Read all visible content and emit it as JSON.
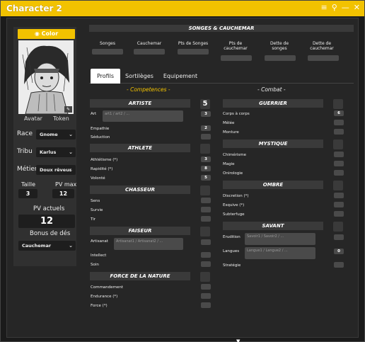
{
  "window": {
    "title": "Character 2",
    "accent": "#f2c200"
  },
  "left": {
    "color_button": "Color",
    "avatar_label": "Avatar",
    "token_label": "Token",
    "race_label": "Race",
    "race_value": "Gnome",
    "tribu_label": "Tribu",
    "tribu_value": "Karlus",
    "metier_label": "Métier",
    "metier_value": "Doux rêveur",
    "taille_label": "Taille",
    "taille_value": "3",
    "pvmax_label": "PV max",
    "pvmax_value": "12",
    "pv_actuels_label": "PV actuels",
    "pv_actuels_value": "12",
    "bonus_label": "Bonus de dés",
    "bonus_value": "Cauchemar"
  },
  "songes": {
    "title": "SONGES & CAUCHEMAR",
    "labels": [
      "Songes",
      "Cauchemar",
      "Pts de Songes",
      "Pts de cauchemar",
      "Dette de songes",
      "Dette de cauchemar"
    ]
  },
  "tabs": [
    "Profils",
    "Sortilèges",
    "Equipement"
  ],
  "competences_title": "- Competences -",
  "combat_title": "- Combat -",
  "left_cats": {
    "artiste": {
      "name": "ARTISTE",
      "value": "5",
      "art": "Art",
      "art_placeholder": "art1 / art2 / ...",
      "art_val": "3",
      "empathie": "Empathie",
      "empathie_val": "2",
      "seduction": "Séduction"
    },
    "athlete": {
      "name": "ATHLETE",
      "athletisme": "Athlétisme (*)",
      "athletisme_val": "3",
      "rapidite": "Rapidité (*)",
      "rapidite_val": "8",
      "volonte": "Volonté",
      "volonte_val": "5"
    },
    "chasseur": {
      "name": "CHASSEUR",
      "sens": "Sens",
      "survie": "Survie",
      "tir": "Tir"
    },
    "faiseur": {
      "name": "FAISEUR",
      "artisanat": "Artisanat",
      "artisanat_placeholder": "Artisanat1 / Artisanat2 / ...",
      "intellect": "Intellect",
      "soin": "Soin"
    },
    "force": {
      "name": "FORCE DE LA NATURE",
      "commandement": "Commandement",
      "endurance": "Endurance (*)",
      "force": "Force (*)"
    }
  },
  "right_cats": {
    "guerrier": {
      "name": "GUERRIER",
      "corps": "Corps à corps",
      "corps_val": "6",
      "melee": "Mêlée",
      "monture": "Monture"
    },
    "mystique": {
      "name": "MYSTIQUE",
      "chimerisme": "Chimérisme",
      "magie": "Magie",
      "oniro": "Onirologie"
    },
    "ombre": {
      "name": "OMBRE",
      "discretion": "Discretion (*)",
      "esquive": "Esquive (*)",
      "subterfuge": "Subterfuge"
    },
    "savant": {
      "name": "SAVANT",
      "erudition": "Erudition",
      "erudition_placeholder": "Savoir1 / Savoir2 / ...",
      "langues": "Langues",
      "langues_placeholder": "Langue1 / Langue2 / ...",
      "langues_val": "0",
      "strategie": "Stratégie"
    }
  }
}
